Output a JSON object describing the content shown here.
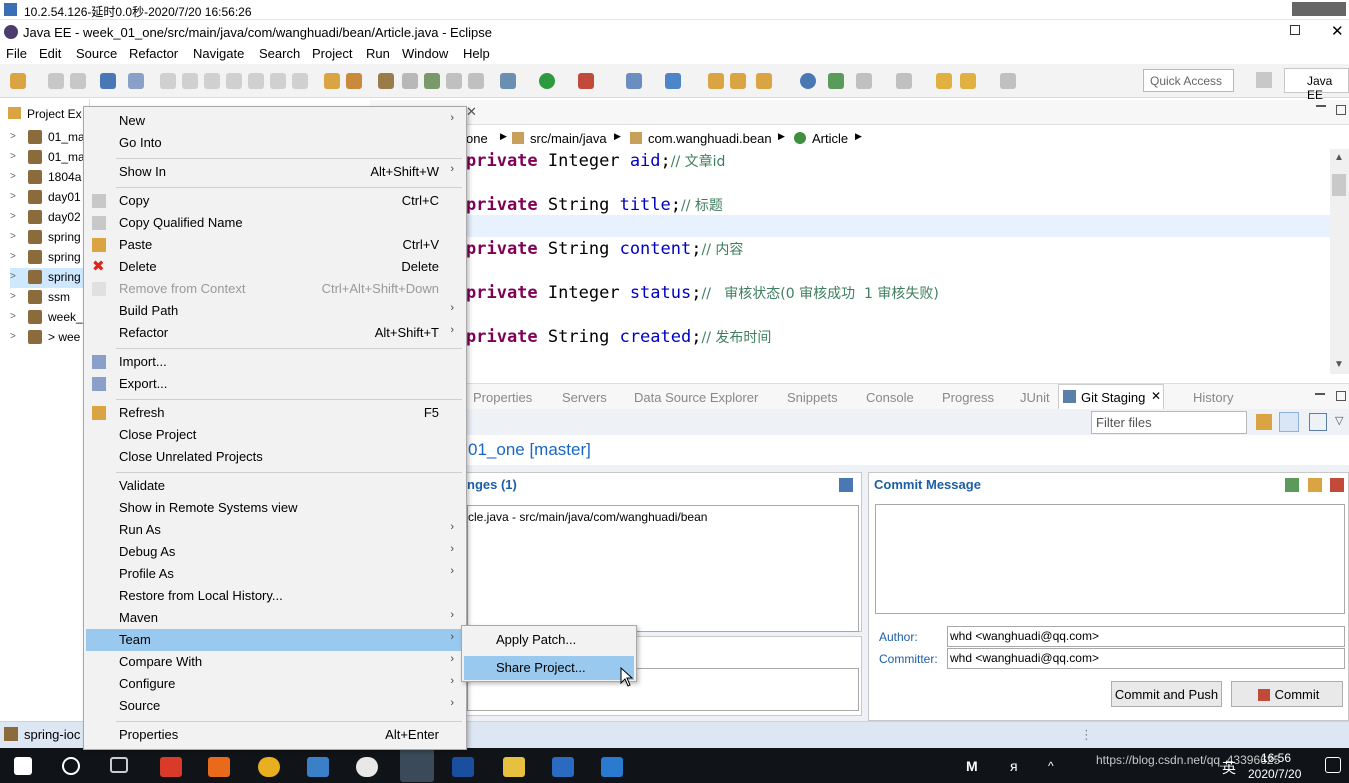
{
  "remote_title": "10.2.54.126-延时0.0秒-2020/7/20 16:56:26",
  "window_title": "Java EE - week_01_one/src/main/java/com/wanghuadi/bean/Article.java - Eclipse",
  "menu": [
    "File",
    "Edit",
    "Source",
    "Refactor",
    "Navigate",
    "Search",
    "Project",
    "Run",
    "Window",
    "Help"
  ],
  "quick_access": "Quick Access",
  "perspective": "Java EE",
  "project_explorer_label": "Project Ex",
  "tree": [
    "01_ma",
    "01_ma",
    "1804a",
    "day01",
    "day02",
    "spring",
    "spring",
    "spring",
    "ssm",
    "week_",
    "> wee"
  ],
  "breadcrumb": [
    "one",
    "src/main/java",
    "com.wanghuadi.bean",
    "Article"
  ],
  "code": [
    {
      "kw": "private",
      "type": "Integer",
      "name": "aid",
      "comment": "// 文章id"
    },
    {
      "kw": "private",
      "type": "String",
      "name": "title",
      "comment": "// 标题"
    },
    {
      "kw": "private",
      "type": "String",
      "name": "content",
      "comment": "// 内容"
    },
    {
      "kw": "private",
      "type": "Integer",
      "name": "status",
      "comment": "//   审核状态(0 审核成功  1 审核失败)"
    },
    {
      "kw": "private",
      "type": "String",
      "name": "created",
      "comment": "// 发布时间"
    }
  ],
  "view_tabs": [
    "Properties",
    "Servers",
    "Data Source Explorer",
    "Snippets",
    "Console",
    "Progress",
    "JUnit",
    "Git Staging",
    "History"
  ],
  "git": {
    "filter_placeholder": "Filter files",
    "repo": "01_one [master]",
    "unstaged_title": "nges (1)",
    "unstaged_file": "cle.java - src/main/java/com/wanghuadi/bean",
    "commit_message_title": "Commit Message",
    "author_label": "Author:",
    "author": "whd <wanghuadi@qq.com>",
    "committer_label": "Committer:",
    "committer": "whd <wanghuadi@qq.com>",
    "commit_push": "Commit and Push",
    "commit": "Commit"
  },
  "status_bar": "spring-ioc",
  "context_menu": [
    {
      "label": "New",
      "arrow": true
    },
    {
      "label": "Go Into"
    },
    {
      "label": "Show In",
      "shortcut": "Alt+Shift+W",
      "arrow": true
    },
    {
      "label": "Copy",
      "shortcut": "Ctrl+C"
    },
    {
      "label": "Copy Qualified Name"
    },
    {
      "label": "Paste",
      "shortcut": "Ctrl+V"
    },
    {
      "label": "Delete",
      "shortcut": "Delete"
    },
    {
      "label": "Remove from Context",
      "shortcut": "Ctrl+Alt+Shift+Down",
      "disabled": true
    },
    {
      "label": "Build Path",
      "arrow": true
    },
    {
      "label": "Refactor",
      "shortcut": "Alt+Shift+T",
      "arrow": true
    },
    {
      "label": "Import..."
    },
    {
      "label": "Export..."
    },
    {
      "label": "Refresh",
      "shortcut": "F5"
    },
    {
      "label": "Close Project"
    },
    {
      "label": "Close Unrelated Projects"
    },
    {
      "label": "Validate"
    },
    {
      "label": "Show in Remote Systems view"
    },
    {
      "label": "Run As",
      "arrow": true
    },
    {
      "label": "Debug As",
      "arrow": true
    },
    {
      "label": "Profile As",
      "arrow": true
    },
    {
      "label": "Restore from Local History..."
    },
    {
      "label": "Maven",
      "arrow": true
    },
    {
      "label": "Team",
      "arrow": true,
      "highlighted": true
    },
    {
      "label": "Compare With",
      "arrow": true
    },
    {
      "label": "Configure",
      "arrow": true
    },
    {
      "label": "Source",
      "arrow": true
    },
    {
      "label": "Properties",
      "shortcut": "Alt+Enter"
    }
  ],
  "submenu": [
    {
      "label": "Apply Patch..."
    },
    {
      "label": "Share Project...",
      "highlighted": true
    }
  ],
  "taskbar": {
    "url_text": "https://blog.csdn.net/qq_43396625",
    "time": "16:56",
    "date": "2020/7/20",
    "ime": "英"
  }
}
